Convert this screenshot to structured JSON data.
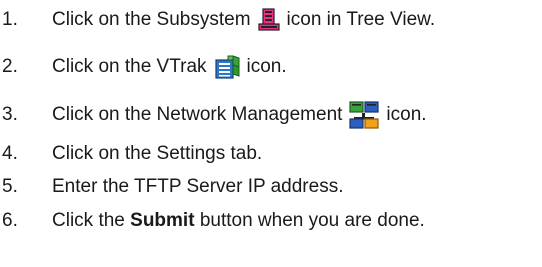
{
  "steps": [
    {
      "number": "1.",
      "before": "Click on the Subsystem",
      "icon": "subsystem-icon",
      "after": "icon in Tree View."
    },
    {
      "number": "2.",
      "before": "Click on the VTrak",
      "icon": "vtrak-icon",
      "after": "icon."
    },
    {
      "number": "3.",
      "before": "Click on the Network Management",
      "icon": "network-management-icon",
      "after": "icon."
    },
    {
      "number": "4.",
      "text": "Click on the Settings tab."
    },
    {
      "number": "5.",
      "text": "Enter the TFTP Server IP address."
    },
    {
      "number": "6.",
      "before": "Click the",
      "bold": "Submit",
      "after": "button when you are done."
    }
  ],
  "colors": {
    "text": "#1a1a1a",
    "subsystem_icon": "#e8308a",
    "vtrak_icon": "#2b78c8",
    "network_icon_green": "#3aa23a",
    "network_icon_blue": "#2b5fbf",
    "network_icon_orange": "#f2a21a"
  }
}
